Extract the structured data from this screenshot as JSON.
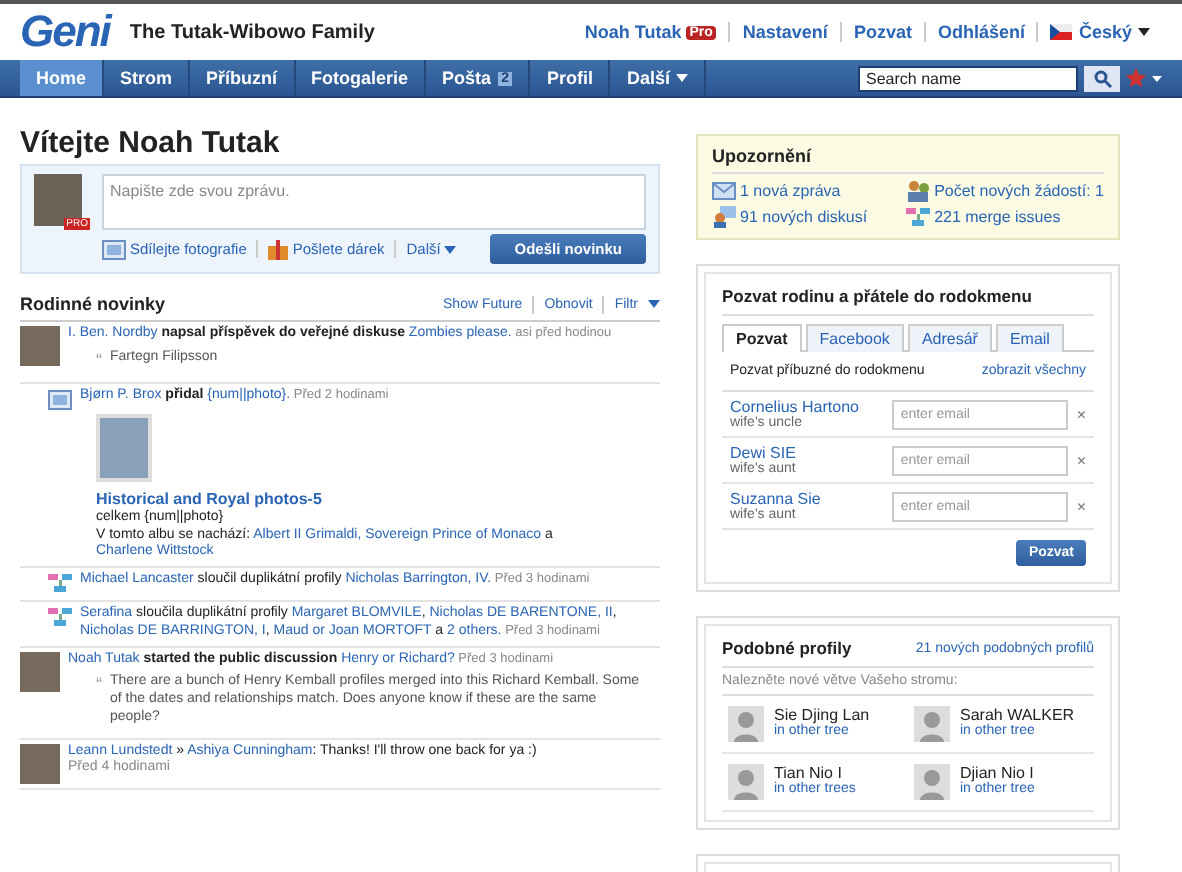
{
  "header": {
    "logo": "Geni",
    "family": "The Tutak-Wibowo Family",
    "user": "Noah Tutak",
    "pro_badge": "Pro",
    "links": [
      "Nastavení",
      "Pozvat",
      "Odhlášení"
    ],
    "language": "Český"
  },
  "nav": {
    "tabs": [
      {
        "label": "Home",
        "selected": true
      },
      {
        "label": "Strom",
        "selected": false
      },
      {
        "label": "Příbuzní",
        "selected": false
      },
      {
        "label": "Fotogalerie",
        "selected": false
      },
      {
        "label": "Pošta",
        "selected": false,
        "badge": "2"
      },
      {
        "label": "Profil",
        "selected": false
      },
      {
        "label": "Další",
        "selected": false,
        "menu": true
      }
    ],
    "search": {
      "placeholder": "Search name"
    }
  },
  "welcome": {
    "title": "Vítejte Noah Tutak",
    "composer_placeholder": "Napište zde svou zprávu.",
    "avatar_badge": "PRO",
    "actions": [
      "Sdílejte fotografie",
      "Pošlete dárek",
      "Další"
    ],
    "submit": "Odešli novinku"
  },
  "feed": {
    "title": "Rodinné novinky",
    "actions": [
      "Show Future",
      "Obnovit",
      "Filtr"
    ],
    "items": [
      {
        "kind": "avatar",
        "text": [
          {
            "kind": "link",
            "text": "I. Ben. Nordby"
          },
          {
            "kind": "bold",
            "text": " napsal příspěvek do veřejné diskuse "
          },
          {
            "kind": "link",
            "text": "Zombies please."
          },
          {
            "kind": "time",
            "text": " asi před hodinou"
          }
        ],
        "quote_mark": "“",
        "quote": "Fartegn Filipsson"
      },
      {
        "kind": "photo",
        "text": [
          {
            "kind": "link",
            "text": "Bjørn P. Brox"
          },
          {
            "kind": "bold",
            "text": " přidal "
          },
          {
            "kind": "link",
            "text": "{num||photo}."
          },
          {
            "kind": "time",
            "text": " Před 2 hodinami"
          }
        ],
        "album": {
          "title": "Historical and Royal photos-5",
          "count": "celkem {num||photo}",
          "people": [
            {
              "kind": "plain",
              "text": "V tomto albu se nachází: "
            },
            {
              "kind": "link",
              "text": "Albert II Grimaldi, Sovereign Prince of Monaco"
            },
            {
              "kind": "plain",
              "text": " a "
            },
            {
              "kind": "link",
              "text": "Charlene Wittstock"
            }
          ]
        }
      },
      {
        "kind": "merge",
        "text": [
          {
            "kind": "link",
            "text": "Michael Lancaster"
          },
          {
            "kind": "plain",
            "text": " sloučil duplikátní profily "
          },
          {
            "kind": "link",
            "text": "Nicholas Barrington, IV."
          },
          {
            "kind": "time",
            "text": " Před 3 hodinami"
          }
        ]
      },
      {
        "kind": "merge",
        "text": [
          {
            "kind": "link",
            "text": "Serafina"
          },
          {
            "kind": "plain",
            "text": " sloučila duplikátní profily "
          },
          {
            "kind": "link",
            "text": "Margaret BLOMVILE"
          },
          {
            "kind": "plain",
            "text": ", "
          },
          {
            "kind": "link",
            "text": "Nicholas DE BARENTONE, II"
          },
          {
            "kind": "plain",
            "text": ", "
          },
          {
            "kind": "link",
            "text": "Nicholas DE BARRINGTON, I"
          },
          {
            "kind": "plain",
            "text": ", "
          },
          {
            "kind": "link",
            "text": "Maud or Joan MORTOFT"
          },
          {
            "kind": "plain",
            "text": " a "
          },
          {
            "kind": "link",
            "text": "2 others."
          },
          {
            "kind": "time",
            "text": " Před 3 hodinami"
          }
        ]
      },
      {
        "kind": "avatar",
        "text": [
          {
            "kind": "link",
            "text": "Noah Tutak"
          },
          {
            "kind": "bold",
            "text": " started the public discussion "
          },
          {
            "kind": "link",
            "text": "Henry or Richard?"
          },
          {
            "kind": "time",
            "text": " Před 3 hodinami"
          }
        ],
        "quote_mark": "“",
        "quote": "There are a bunch of Henry Kemball profiles merged into this Richard Kemball. Some of the dates and relationships match. Does anyone know if these are the same people?"
      },
      {
        "kind": "avatar",
        "text": [
          {
            "kind": "link",
            "text": "Leann Lundstedt"
          },
          {
            "kind": "plain",
            "text": " » "
          },
          {
            "kind": "link",
            "text": "Ashiya Cunningham"
          },
          {
            "kind": "plain",
            "text": ": Thanks! I'll throw one back for ya :)"
          }
        ],
        "time": "Před 4 hodinami"
      }
    ]
  },
  "alerts": {
    "title": "Upozornění",
    "items": [
      {
        "kind": "mail",
        "text": "1 nová zpráva"
      },
      {
        "kind": "requests",
        "text": "Počet nových žádostí: 1"
      },
      {
        "kind": "discussion",
        "text": "91 nových diskusí"
      },
      {
        "kind": "merge",
        "text": "221 merge issues"
      }
    ]
  },
  "invite": {
    "title": "Pozvat rodinu a přátele do rodokmenu",
    "tabs": [
      {
        "label": "Pozvat",
        "selected": true
      },
      {
        "label": "Facebook",
        "selected": false
      },
      {
        "label": "Adresář",
        "selected": false
      },
      {
        "label": "Email",
        "selected": false
      }
    ],
    "subtitle": "Pozvat příbuzné do rodokmenu",
    "show_all": "zobrazit všechny",
    "people": [
      {
        "name": "Cornelius Hartono",
        "relation": "wife's uncle",
        "placeholder": "enter email"
      },
      {
        "name": "Dewi SIE",
        "relation": "wife's aunt",
        "placeholder": "enter email"
      },
      {
        "name": "Suzanna Sie",
        "relation": "wife's aunt",
        "placeholder": "enter email"
      }
    ],
    "remove": "×",
    "submit": "Pozvat"
  },
  "similar": {
    "title": "Podobné profily",
    "link": "21 nových podobných profilů",
    "subtitle": "Nalezněte nové větve Vašeho stromu:",
    "profiles": [
      {
        "name": "Sie Djing Lan",
        "tree": "in other tree"
      },
      {
        "name": "Sarah WALKER",
        "tree": "in other tree"
      },
      {
        "name": "Tian Nio I",
        "tree": "in other trees"
      },
      {
        "name": "Djian Nio I",
        "tree": "in other tree"
      }
    ]
  }
}
